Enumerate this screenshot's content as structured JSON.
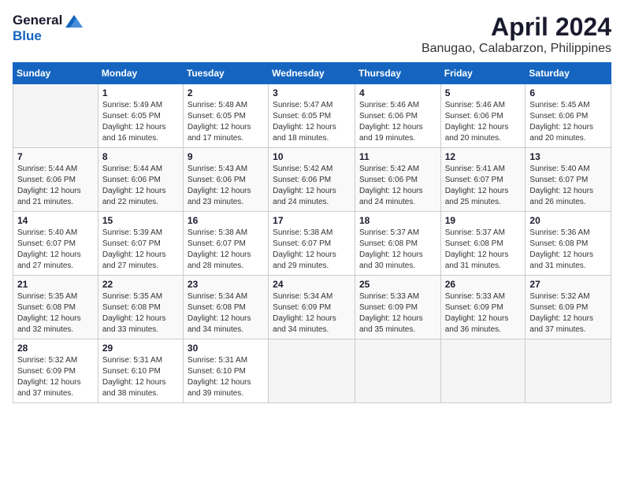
{
  "header": {
    "logo_general": "General",
    "logo_blue": "Blue",
    "month_title": "April 2024",
    "location": "Banugao, Calabarzon, Philippines"
  },
  "calendar": {
    "days_of_week": [
      "Sunday",
      "Monday",
      "Tuesday",
      "Wednesday",
      "Thursday",
      "Friday",
      "Saturday"
    ],
    "weeks": [
      [
        {
          "day": "",
          "sunrise": "",
          "sunset": "",
          "daylight": ""
        },
        {
          "day": "1",
          "sunrise": "Sunrise: 5:49 AM",
          "sunset": "Sunset: 6:05 PM",
          "daylight": "Daylight: 12 hours and 16 minutes."
        },
        {
          "day": "2",
          "sunrise": "Sunrise: 5:48 AM",
          "sunset": "Sunset: 6:05 PM",
          "daylight": "Daylight: 12 hours and 17 minutes."
        },
        {
          "day": "3",
          "sunrise": "Sunrise: 5:47 AM",
          "sunset": "Sunset: 6:05 PM",
          "daylight": "Daylight: 12 hours and 18 minutes."
        },
        {
          "day": "4",
          "sunrise": "Sunrise: 5:46 AM",
          "sunset": "Sunset: 6:06 PM",
          "daylight": "Daylight: 12 hours and 19 minutes."
        },
        {
          "day": "5",
          "sunrise": "Sunrise: 5:46 AM",
          "sunset": "Sunset: 6:06 PM",
          "daylight": "Daylight: 12 hours and 20 minutes."
        },
        {
          "day": "6",
          "sunrise": "Sunrise: 5:45 AM",
          "sunset": "Sunset: 6:06 PM",
          "daylight": "Daylight: 12 hours and 20 minutes."
        }
      ],
      [
        {
          "day": "7",
          "sunrise": "Sunrise: 5:44 AM",
          "sunset": "Sunset: 6:06 PM",
          "daylight": "Daylight: 12 hours and 21 minutes."
        },
        {
          "day": "8",
          "sunrise": "Sunrise: 5:44 AM",
          "sunset": "Sunset: 6:06 PM",
          "daylight": "Daylight: 12 hours and 22 minutes."
        },
        {
          "day": "9",
          "sunrise": "Sunrise: 5:43 AM",
          "sunset": "Sunset: 6:06 PM",
          "daylight": "Daylight: 12 hours and 23 minutes."
        },
        {
          "day": "10",
          "sunrise": "Sunrise: 5:42 AM",
          "sunset": "Sunset: 6:06 PM",
          "daylight": "Daylight: 12 hours and 24 minutes."
        },
        {
          "day": "11",
          "sunrise": "Sunrise: 5:42 AM",
          "sunset": "Sunset: 6:06 PM",
          "daylight": "Daylight: 12 hours and 24 minutes."
        },
        {
          "day": "12",
          "sunrise": "Sunrise: 5:41 AM",
          "sunset": "Sunset: 6:07 PM",
          "daylight": "Daylight: 12 hours and 25 minutes."
        },
        {
          "day": "13",
          "sunrise": "Sunrise: 5:40 AM",
          "sunset": "Sunset: 6:07 PM",
          "daylight": "Daylight: 12 hours and 26 minutes."
        }
      ],
      [
        {
          "day": "14",
          "sunrise": "Sunrise: 5:40 AM",
          "sunset": "Sunset: 6:07 PM",
          "daylight": "Daylight: 12 hours and 27 minutes."
        },
        {
          "day": "15",
          "sunrise": "Sunrise: 5:39 AM",
          "sunset": "Sunset: 6:07 PM",
          "daylight": "Daylight: 12 hours and 27 minutes."
        },
        {
          "day": "16",
          "sunrise": "Sunrise: 5:38 AM",
          "sunset": "Sunset: 6:07 PM",
          "daylight": "Daylight: 12 hours and 28 minutes."
        },
        {
          "day": "17",
          "sunrise": "Sunrise: 5:38 AM",
          "sunset": "Sunset: 6:07 PM",
          "daylight": "Daylight: 12 hours and 29 minutes."
        },
        {
          "day": "18",
          "sunrise": "Sunrise: 5:37 AM",
          "sunset": "Sunset: 6:08 PM",
          "daylight": "Daylight: 12 hours and 30 minutes."
        },
        {
          "day": "19",
          "sunrise": "Sunrise: 5:37 AM",
          "sunset": "Sunset: 6:08 PM",
          "daylight": "Daylight: 12 hours and 31 minutes."
        },
        {
          "day": "20",
          "sunrise": "Sunrise: 5:36 AM",
          "sunset": "Sunset: 6:08 PM",
          "daylight": "Daylight: 12 hours and 31 minutes."
        }
      ],
      [
        {
          "day": "21",
          "sunrise": "Sunrise: 5:35 AM",
          "sunset": "Sunset: 6:08 PM",
          "daylight": "Daylight: 12 hours and 32 minutes."
        },
        {
          "day": "22",
          "sunrise": "Sunrise: 5:35 AM",
          "sunset": "Sunset: 6:08 PM",
          "daylight": "Daylight: 12 hours and 33 minutes."
        },
        {
          "day": "23",
          "sunrise": "Sunrise: 5:34 AM",
          "sunset": "Sunset: 6:08 PM",
          "daylight": "Daylight: 12 hours and 34 minutes."
        },
        {
          "day": "24",
          "sunrise": "Sunrise: 5:34 AM",
          "sunset": "Sunset: 6:09 PM",
          "daylight": "Daylight: 12 hours and 34 minutes."
        },
        {
          "day": "25",
          "sunrise": "Sunrise: 5:33 AM",
          "sunset": "Sunset: 6:09 PM",
          "daylight": "Daylight: 12 hours and 35 minutes."
        },
        {
          "day": "26",
          "sunrise": "Sunrise: 5:33 AM",
          "sunset": "Sunset: 6:09 PM",
          "daylight": "Daylight: 12 hours and 36 minutes."
        },
        {
          "day": "27",
          "sunrise": "Sunrise: 5:32 AM",
          "sunset": "Sunset: 6:09 PM",
          "daylight": "Daylight: 12 hours and 37 minutes."
        }
      ],
      [
        {
          "day": "28",
          "sunrise": "Sunrise: 5:32 AM",
          "sunset": "Sunset: 6:09 PM",
          "daylight": "Daylight: 12 hours and 37 minutes."
        },
        {
          "day": "29",
          "sunrise": "Sunrise: 5:31 AM",
          "sunset": "Sunset: 6:10 PM",
          "daylight": "Daylight: 12 hours and 38 minutes."
        },
        {
          "day": "30",
          "sunrise": "Sunrise: 5:31 AM",
          "sunset": "Sunset: 6:10 PM",
          "daylight": "Daylight: 12 hours and 39 minutes."
        },
        {
          "day": "",
          "sunrise": "",
          "sunset": "",
          "daylight": ""
        },
        {
          "day": "",
          "sunrise": "",
          "sunset": "",
          "daylight": ""
        },
        {
          "day": "",
          "sunrise": "",
          "sunset": "",
          "daylight": ""
        },
        {
          "day": "",
          "sunrise": "",
          "sunset": "",
          "daylight": ""
        }
      ]
    ]
  }
}
